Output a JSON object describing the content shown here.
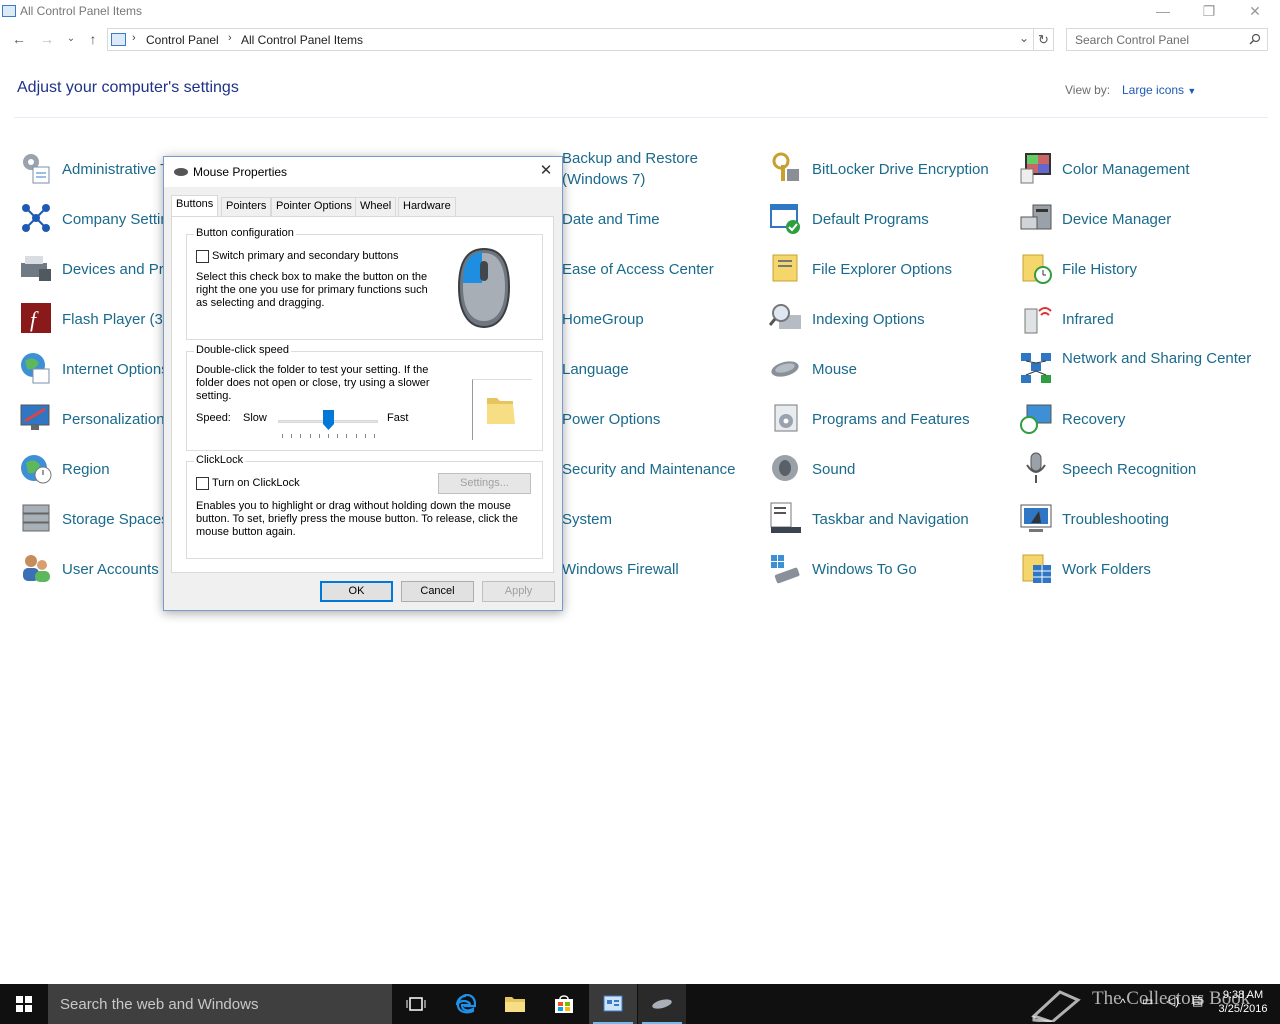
{
  "window": {
    "title": "All Control Panel Items"
  },
  "address": {
    "crumbs": [
      "Control Panel",
      "All Control Panel Items"
    ],
    "search_placeholder": "Search Control Panel"
  },
  "header": {
    "heading": "Adjust your computer's settings",
    "view_by_label": "View by:",
    "view_by_value": "Large icons"
  },
  "items": {
    "col1": [
      "Administrative Tools",
      "Company Settings",
      "Devices and Printers",
      "Flash Player (32-bit)",
      "Internet Options",
      "Personalization",
      "Region",
      "Storage Spaces",
      "User Accounts"
    ],
    "col3": [
      "Backup and Restore (Windows 7)",
      "Date and Time",
      "Ease of Access Center",
      "HomeGroup",
      "Language",
      "Power Options",
      "Security and Maintenance",
      "System",
      "Windows Firewall"
    ],
    "col4": [
      "BitLocker Drive Encryption",
      "Default Programs",
      "File Explorer Options",
      "Indexing Options",
      "Mouse",
      "Programs and Features",
      "Sound",
      "Taskbar and Navigation",
      "Windows To Go"
    ],
    "col5": [
      "Color Management",
      "Device Manager",
      "File History",
      "Infrared",
      "Network and Sharing Center",
      "Recovery",
      "Speech Recognition",
      "Troubleshooting",
      "Work Folders"
    ]
  },
  "dialog": {
    "title": "Mouse Properties",
    "tabs": [
      "Buttons",
      "Pointers",
      "Pointer Options",
      "Wheel",
      "Hardware"
    ],
    "button_config": {
      "title": "Button configuration",
      "checkbox_label": "Switch primary and secondary buttons",
      "checked": false,
      "description": "Select this check box to make the button on the right the one you use for primary functions such as selecting and dragging."
    },
    "double_click": {
      "title": "Double-click speed",
      "description": "Double-click the folder to test your setting. If the folder does not open or close, try using a slower setting.",
      "speed_label": "Speed:",
      "slow": "Slow",
      "fast": "Fast",
      "speed_value": 6,
      "speed_max": 11
    },
    "clicklock": {
      "title": "ClickLock",
      "checkbox_label": "Turn on ClickLock",
      "checked": false,
      "settings_button": "Settings...",
      "description": "Enables you to highlight or drag without holding down the mouse button. To set, briefly press the mouse button. To release, click the mouse button again."
    },
    "buttons": {
      "ok": "OK",
      "cancel": "Cancel",
      "apply": "Apply"
    }
  },
  "taskbar": {
    "search_text": "Search the web and Windows",
    "time": "9:38 AM",
    "date": "3/25/2016",
    "watermark": "The Collectors Book"
  },
  "colors": {
    "link": "#1a6a8c",
    "heading": "#1e3287",
    "accent": "#0078d7",
    "taskbar": "#101010"
  }
}
